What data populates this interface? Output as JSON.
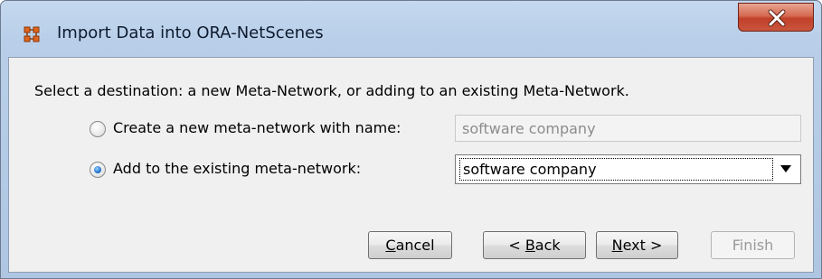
{
  "window": {
    "title": "Import Data into ORA-NetScenes",
    "close_glyph": "X"
  },
  "dialog": {
    "prompt": "Select a destination: a new Meta-Network, or adding to an existing Meta-Network.",
    "option_new": {
      "label": "Create a new meta-network with name:",
      "checked": false,
      "placeholder": "software company"
    },
    "option_existing": {
      "label": "Add to the existing meta-network:",
      "checked": true,
      "selected_value": "software company"
    }
  },
  "buttons": {
    "cancel_mnemonic": "C",
    "cancel_rest": "ancel",
    "back_prefix": "< ",
    "back_mnemonic": "B",
    "back_rest": "ack",
    "next_mnemonic": "N",
    "next_rest": "ext >",
    "finish_label": "Finish"
  },
  "colors": {
    "title_bar": "#b9cfe9",
    "close_button": "#c9553c",
    "dialog_bg": "#f0f0f0",
    "radio_selected": "#2a7bd6"
  }
}
